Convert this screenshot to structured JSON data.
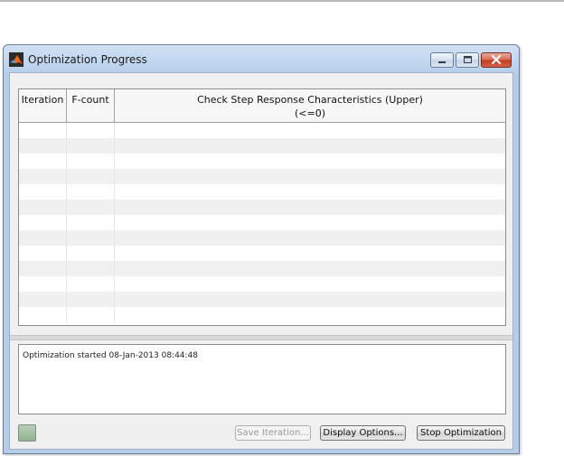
{
  "window": {
    "title": "Optimization Progress",
    "controls": {
      "minimize": "minimize-icon",
      "maximize": "maximize-icon",
      "close": "close-icon"
    }
  },
  "table": {
    "columns": [
      {
        "label": "Iteration"
      },
      {
        "label": "F-count"
      },
      {
        "label_line1": "Check Step Response  Characteristics (Upper)",
        "label_line2": "(<=0)"
      }
    ],
    "row_count": 13
  },
  "log": {
    "text": "Optimization started 08-Jan-2013 08:44:48"
  },
  "buttons": {
    "save_iteration": "Save Iteration...",
    "display_options": "Display Options...",
    "stop_optimization": "Stop  Optimization"
  },
  "colors": {
    "titlebar": "#bcd3ee",
    "close_button": "#c2391d",
    "status_indicator": "#8fb38f"
  }
}
